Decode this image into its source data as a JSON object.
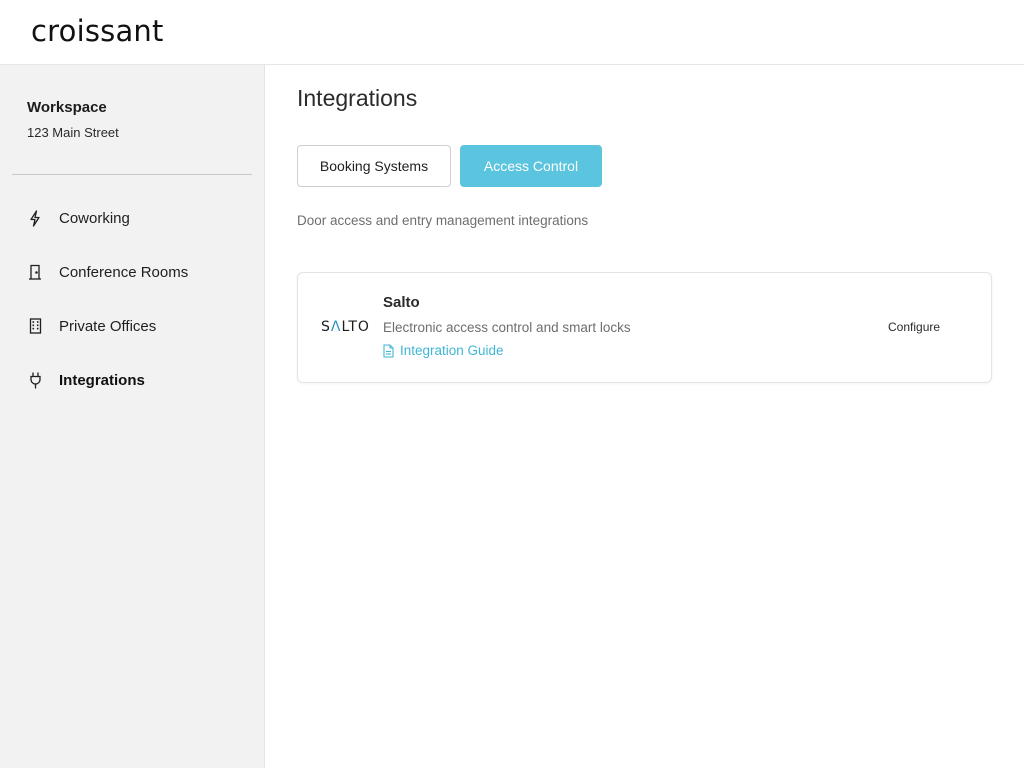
{
  "app": {
    "logo_text": "croissant"
  },
  "sidebar": {
    "workspace_name": "Workspace",
    "workspace_address": "123 Main Street",
    "items": [
      {
        "label": "Coworking",
        "icon": "bolt-icon",
        "active": false
      },
      {
        "label": "Conference Rooms",
        "icon": "door-icon",
        "active": false
      },
      {
        "label": "Private Offices",
        "icon": "building-icon",
        "active": false
      },
      {
        "label": "Integrations",
        "icon": "plug-icon",
        "active": true
      }
    ]
  },
  "main": {
    "title": "Integrations",
    "tabs": [
      {
        "label": "Booking Systems",
        "selected": false
      },
      {
        "label": "Access Control",
        "selected": true
      }
    ],
    "subtitle": "Door access and entry management integrations",
    "integrations": [
      {
        "logo_text": "SALTO",
        "name": "Salto",
        "description": "Electronic access control and smart locks",
        "guide_label": "Integration Guide",
        "action_label": "Configure"
      }
    ]
  },
  "colors": {
    "accent": "#5bc4de",
    "link": "#41b6d4",
    "sidebar_bg": "#f2f2f2"
  }
}
